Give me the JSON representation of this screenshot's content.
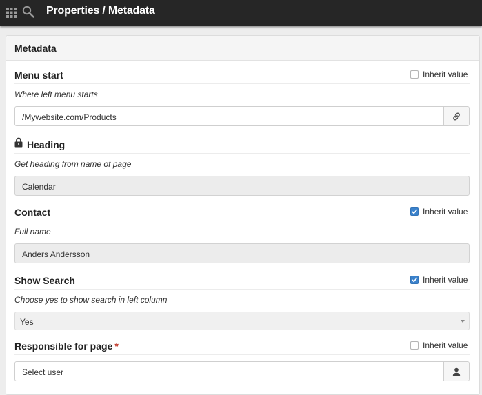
{
  "topbar": {
    "title": "Properties / Metadata",
    "icons": [
      "apps-grid-icon",
      "search-icon"
    ],
    "background": "#262626"
  },
  "panel": {
    "title": "Metadata"
  },
  "inherit_label": "Inherit value",
  "accent": "#3b82cc",
  "fields": {
    "menu_start": {
      "label": "Menu start",
      "help": "Where left menu starts",
      "value": "/Mywebsite.com/Products",
      "inherit_checked": false,
      "addon_icon": "link-icon"
    },
    "heading": {
      "label": "Heading",
      "locked": true,
      "help": "Get heading from name of page",
      "value": "Calendar"
    },
    "contact": {
      "label": "Contact",
      "help": "Full name",
      "value": "Anders Andersson",
      "inherit_checked": true
    },
    "show_search": {
      "label": "Show Search",
      "help": "Choose yes to show search in left column",
      "value": "Yes",
      "inherit_checked": true
    },
    "responsible": {
      "label": "Responsible for page",
      "required_marker": "*",
      "value": "Select user",
      "inherit_checked": false,
      "addon_icon": "user-icon"
    }
  }
}
